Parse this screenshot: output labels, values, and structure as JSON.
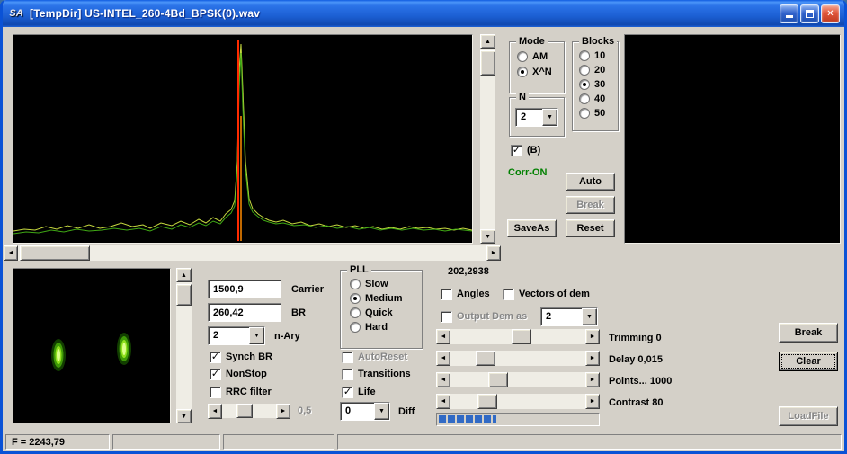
{
  "window": {
    "title": "[TempDir] US-INTEL_260-4Bd_BPSK(0).wav",
    "icon_text": "SA"
  },
  "icons": {
    "check": "✓",
    "dropdown": "▼",
    "close": "✕",
    "up": "▲",
    "down": "▼",
    "left": "◄",
    "right": "►"
  },
  "top": {
    "mode": {
      "label": "Mode",
      "am": "AM",
      "xn": "X^N",
      "selected": "X^N"
    },
    "blocks": {
      "label": "Blocks",
      "opts": [
        "10",
        "20",
        "30",
        "40",
        "50"
      ],
      "selected": "30"
    },
    "n": {
      "label": "N",
      "value": "2"
    },
    "b_label": "(B)",
    "corr": "Corr-ON",
    "auto": "Auto",
    "brk": "Break",
    "saveas": "SaveAs",
    "reset": "Reset"
  },
  "bottom": {
    "carrier": {
      "value": "1500,9",
      "label": "Carrier"
    },
    "br": {
      "value": "260,42",
      "label": "BR"
    },
    "nary": {
      "value": "2",
      "label": "n-Ary"
    },
    "synch": "Synch BR",
    "nonstop": "NonStop",
    "rrc": "RRC filter",
    "mini_slider_value": "0,5",
    "pll": {
      "label": "PLL",
      "opts": [
        "Slow",
        "Medium",
        "Quick",
        "Hard"
      ],
      "selected": "Medium"
    },
    "autoreset": "AutoReset",
    "transitions": "Transitions",
    "life": "Life",
    "diff": {
      "value": "0",
      "label": "Diff"
    }
  },
  "right": {
    "readout": "202,2938",
    "angles": "Angles",
    "vectors": "Vectors of dem",
    "output_dem": {
      "label": "Output Dem as",
      "value": "2"
    },
    "sliders": [
      {
        "label": "Trimming 0",
        "value": "0"
      },
      {
        "label": "Delay  0,015",
        "value": "0,015"
      },
      {
        "label": "Points... 1000",
        "value": "1000"
      },
      {
        "label": "Contrast 80",
        "value": "80"
      }
    ],
    "brk": "Break",
    "clear": "Clear",
    "loadfile": "LoadFile"
  },
  "status": {
    "freq": "F = 2243,79"
  }
}
